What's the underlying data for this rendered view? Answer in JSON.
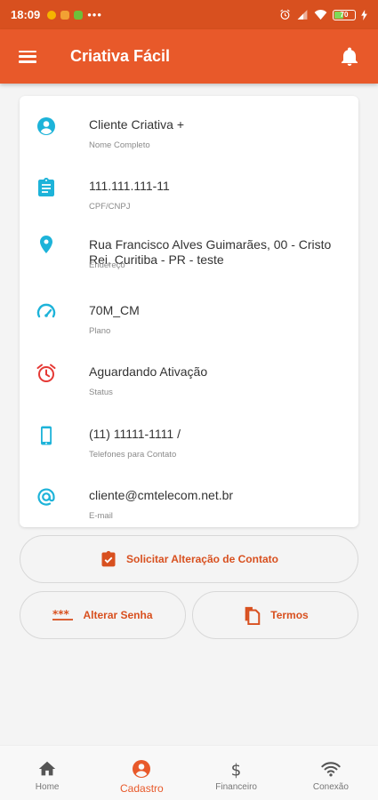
{
  "status_bar": {
    "time": "18:09",
    "more": "•••",
    "battery_level": "70"
  },
  "app": {
    "title": "Criativa Fácil"
  },
  "profile": [
    {
      "icon": "account-circle-icon",
      "value": "Cliente Criativa +",
      "label": "Nome Completo"
    },
    {
      "icon": "clipboard-icon",
      "value": "111.111.111-11",
      "label": "CPF/CNPJ"
    },
    {
      "icon": "map-pin-icon",
      "value": "Rua Francisco Alves Guimarães, 00 - Cristo Rei, Curitiba - PR - teste",
      "label": "Endereço"
    },
    {
      "icon": "speedometer-icon",
      "value": "70M_CM",
      "label": "Plano"
    },
    {
      "icon": "alarm-clock-icon",
      "value": "Aguardando Ativação",
      "label": "Status"
    },
    {
      "icon": "smartphone-icon",
      "value": "(11) 11111-1111 /",
      "label": "Telefones para Contato"
    },
    {
      "icon": "at-sign-icon",
      "value": "cliente@cmtelecom.net.br",
      "label": "E-mail"
    }
  ],
  "actions": {
    "request_change": "Solicitar Alteração de Contato",
    "change_password": "Alterar Senha",
    "terms": "Termos"
  },
  "nav": [
    {
      "icon": "home-icon",
      "label": "Home",
      "active": false
    },
    {
      "icon": "account-icon",
      "label": "Cadastro",
      "active": true
    },
    {
      "icon": "dollar-icon",
      "label": "Financeiro",
      "active": false
    },
    {
      "icon": "wifi-icon",
      "label": "Conexão",
      "active": false
    }
  ],
  "colors": {
    "primary": "#e8592a",
    "status_bar": "#d8501f",
    "icon_cyan": "#1db3d9",
    "icon_red": "#e53935",
    "accent_text": "#d8501f"
  }
}
